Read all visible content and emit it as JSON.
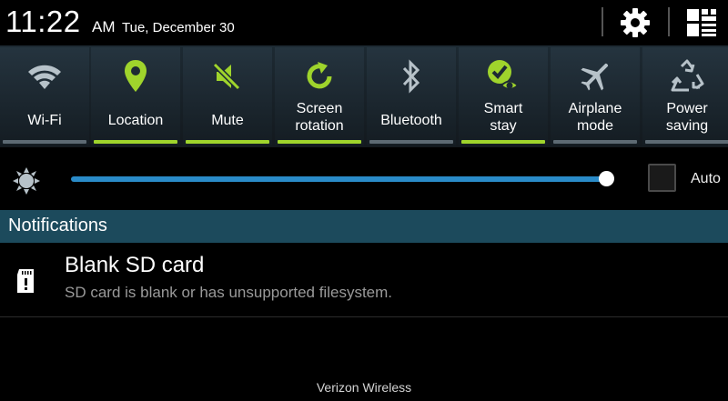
{
  "status_bar": {
    "time": "11:22",
    "ampm": "AM",
    "date": "Tue, December 30",
    "icons": [
      "gear-icon",
      "grid-edit-icon"
    ]
  },
  "quick_settings": {
    "accent_on": "#9fd42c",
    "accent_off": "#5d6a73",
    "items": [
      {
        "label": "Wi-Fi",
        "icon": "wifi-icon",
        "active": false
      },
      {
        "label": "Location",
        "icon": "location-pin-icon",
        "active": true
      },
      {
        "label": "Mute",
        "icon": "mute-icon",
        "active": true
      },
      {
        "label": "Screen\nrotation",
        "icon": "rotation-icon",
        "active": true
      },
      {
        "label": "Bluetooth",
        "icon": "bluetooth-icon",
        "active": false
      },
      {
        "label": "Smart\nstay",
        "icon": "smart-stay-icon",
        "active": true
      },
      {
        "label": "Airplane\nmode",
        "icon": "airplane-icon",
        "active": false
      },
      {
        "label": "Power\nsaving",
        "icon": "recycle-icon",
        "active": false
      }
    ]
  },
  "brightness": {
    "icon": "sun-icon",
    "level": 0.99,
    "auto_label": "Auto",
    "auto_checked": false,
    "track_color": "#2a8bc8"
  },
  "notifications": {
    "header": "Notifications",
    "items": [
      {
        "icon": "sd-card-icon",
        "title": "Blank SD card",
        "body": "SD card is blank or has unsupported filesystem."
      }
    ]
  },
  "carrier": "Verizon Wireless"
}
